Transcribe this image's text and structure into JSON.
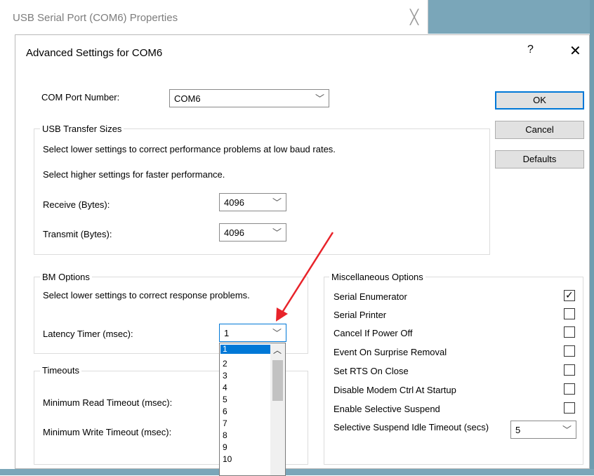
{
  "parent_window": {
    "title": "USB Serial Port (COM6) Properties",
    "close_glyph": "╳"
  },
  "dialog": {
    "title": "Advanced Settings for COM6",
    "help_glyph": "?",
    "close_glyph": "✕"
  },
  "com_port": {
    "label": "COM Port Number:",
    "value": "COM6"
  },
  "buttons": {
    "ok": "OK",
    "cancel": "Cancel",
    "defaults": "Defaults"
  },
  "usb_transfer": {
    "title": "USB Transfer Sizes",
    "hint_lower": "Select lower settings to correct performance problems at low baud rates.",
    "hint_higher": "Select higher settings for faster performance.",
    "receive_label": "Receive (Bytes):",
    "receive_value": "4096",
    "transmit_label": "Transmit (Bytes):",
    "transmit_value": "4096"
  },
  "bm_options": {
    "title": "BM Options",
    "hint": "Select lower settings to correct response problems.",
    "latency_label": "Latency Timer (msec):",
    "latency_value": "1",
    "latency_options": [
      "1",
      "2",
      "3",
      "4",
      "5",
      "6",
      "7",
      "8",
      "9",
      "10"
    ]
  },
  "timeouts": {
    "title": "Timeouts",
    "read_label": "Minimum Read Timeout (msec):",
    "write_label": "Minimum Write Timeout (msec):"
  },
  "misc": {
    "title": "Miscellaneous Options",
    "options": [
      {
        "label": "Serial Enumerator",
        "checked": true
      },
      {
        "label": "Serial Printer",
        "checked": false
      },
      {
        "label": "Cancel If Power Off",
        "checked": false
      },
      {
        "label": "Event On Surprise Removal",
        "checked": false
      },
      {
        "label": "Set RTS On Close",
        "checked": false
      },
      {
        "label": "Disable Modem Ctrl At Startup",
        "checked": false
      },
      {
        "label": "Enable Selective Suspend",
        "checked": false
      }
    ],
    "idle_timeout_label": "Selective Suspend Idle Timeout (secs)",
    "idle_timeout_value": "5"
  },
  "icons": {
    "chevron": "chevron-down-icon",
    "check": "checkmark-icon",
    "scroll_up": "scroll-up-icon"
  },
  "colors": {
    "accent": "#0078d7",
    "annotation_arrow": "#e8232a"
  }
}
